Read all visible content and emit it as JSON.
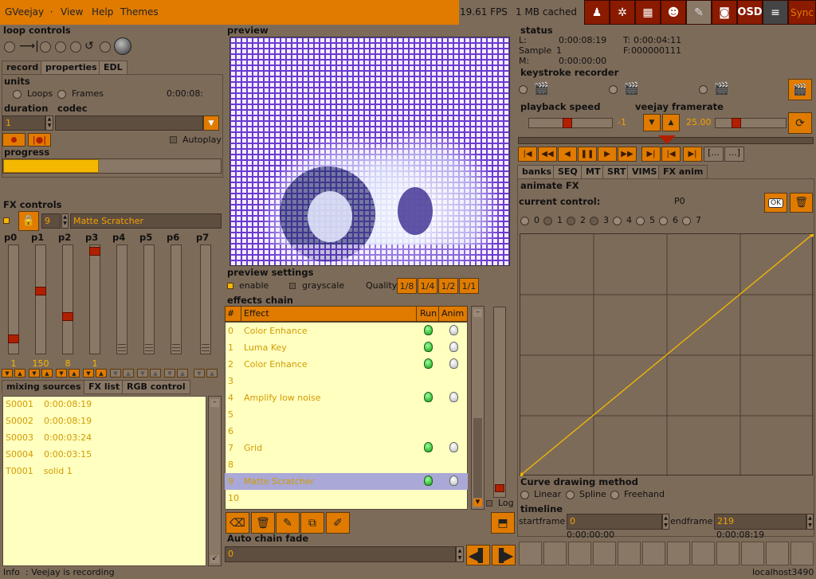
{
  "menubar": {
    "app": "GVeejay",
    "items": [
      "View",
      "Help",
      "Themes"
    ],
    "fps": "19.61 FPS",
    "cached": "1 MB cached",
    "osd": "OSD",
    "sync": "Sync"
  },
  "loop": {
    "title": "loop controls",
    "tabs": [
      "record",
      "properties",
      "EDL"
    ],
    "units_label": "units",
    "unit_loops": "Loops",
    "unit_frames": "Frames",
    "time": "0:00:08:",
    "duration_label": "duration",
    "codec_label": "codec",
    "duration_value": "1",
    "autoplay": "Autoplay",
    "progress_label": "progress",
    "progress_value": 0.44
  },
  "fx": {
    "title": "FX controls",
    "entry": "9",
    "name": "Matte Scratcher",
    "params": [
      "p0",
      "p1",
      "p2",
      "p3",
      "p4",
      "p5",
      "p6",
      "p7"
    ],
    "values": [
      "1",
      "150",
      "8",
      "1",
      "",
      "",
      "",
      ""
    ],
    "levels": [
      0.1,
      0.58,
      0.32,
      0.98,
      null,
      null,
      null,
      null
    ]
  },
  "sources": {
    "tabs": [
      "mixing sources",
      "FX list",
      "RGB control"
    ],
    "items": [
      {
        "id": "S0001",
        "info": "0:00:08:19"
      },
      {
        "id": "S0002",
        "info": "0:00:08:19"
      },
      {
        "id": "S0003",
        "info": "0:00:03:24"
      },
      {
        "id": "S0004",
        "info": "0:00:03:15"
      },
      {
        "id": "T0001",
        "info": "solid 1"
      }
    ]
  },
  "preview": {
    "title": "preview",
    "settings_title": "preview settings",
    "enable": "enable",
    "grayscale": "grayscale",
    "quality_label": "Quality",
    "qualities": [
      "1/8",
      "1/4",
      "1/2",
      "1/1"
    ]
  },
  "chain": {
    "title": "effects chain",
    "headers": [
      "#",
      "Effect",
      "Run",
      "Anim"
    ],
    "rows": [
      {
        "n": "0",
        "effect": "Color Enhance",
        "run": true
      },
      {
        "n": "1",
        "effect": "Luma Key",
        "run": true
      },
      {
        "n": "2",
        "effect": "Color Enhance",
        "run": true
      },
      {
        "n": "3",
        "effect": "",
        "run": false
      },
      {
        "n": "4",
        "effect": "Amplify low noise",
        "run": true
      },
      {
        "n": "5",
        "effect": "",
        "run": false
      },
      {
        "n": "6",
        "effect": "",
        "run": false
      },
      {
        "n": "7",
        "effect": "Grid",
        "run": true
      },
      {
        "n": "8",
        "effect": "",
        "run": false
      },
      {
        "n": "9",
        "effect": "Matte Scratcher",
        "run": true
      },
      {
        "n": "10",
        "effect": "",
        "run": false
      }
    ],
    "log": "Log",
    "fade_title": "Auto chain fade",
    "fade_value": "0"
  },
  "status": {
    "title": "status",
    "l_label": "L:",
    "l_value": "0:00:08:19",
    "t_label": "T:",
    "t_value": "0:00:04:11",
    "sample_label": "Sample",
    "sample_value": "1",
    "f_label": "F:",
    "f_value": "000000111",
    "m_label": "M:",
    "m_value": "0:00:00:00"
  },
  "keystroke": {
    "title": "keystroke recorder"
  },
  "speed": {
    "title": "playback speed",
    "value": "-1",
    "framerate_title": "veejay framerate",
    "framerate_value": "25.00"
  },
  "transport": {
    "extra1": "[...",
    "extra2": "...]"
  },
  "rtabs": [
    "banks",
    "SEQ",
    "MT",
    "SRT",
    "VIMS",
    "FX anim"
  ],
  "anim": {
    "title": "animate FX",
    "current_label": "current control:",
    "current_value": "P0",
    "ok": "OK",
    "params": [
      "0",
      "1",
      "2",
      "3",
      "4",
      "5",
      "6",
      "7"
    ],
    "curve_title": "Curve drawing method",
    "linear": "Linear",
    "spline": "Spline",
    "freehand": "Freehand",
    "timeline_title": "timeline",
    "startframe_label": "startframe",
    "startframe_value": "0",
    "endframe_label": "endframe",
    "endframe_value": "219",
    "start_time": "0:00:00:00",
    "end_time": "0:00:08:19"
  },
  "statusbar": {
    "info": "Info",
    "message": ":  Veejay is recording",
    "host": "localhost3490"
  },
  "colors": {
    "accent": "#e07b00",
    "panel": "#7d6b59",
    "list": "#ffffc0",
    "selected": "#a9a8d6",
    "record": "#b02000"
  }
}
